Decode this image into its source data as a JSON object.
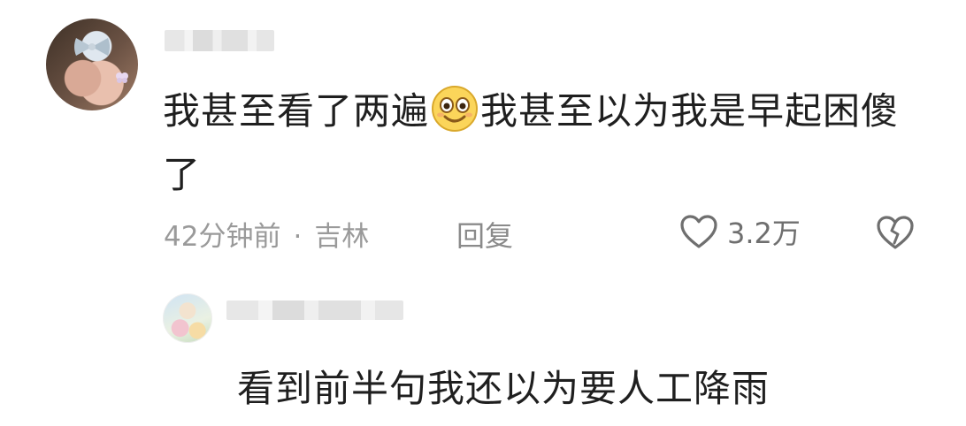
{
  "comment": {
    "text": "我甚至看了两遍😊我甚至以为我是早起困傻了",
    "text_before_emoji": "我甚至看了两遍",
    "emoji": "smiling-face-emoji",
    "text_after_emoji": "我甚至以为我是早起困傻了",
    "time": "42分钟前",
    "separator": "·",
    "location": "吉林",
    "reply_label": "回复",
    "like_count": "3.2万",
    "icons": {
      "like": "heart-outline-icon",
      "dislike": "broken-heart-icon"
    }
  },
  "reply": {
    "text": "看到前半句我还以为要人工降雨"
  },
  "colors": {
    "text": "#1f1f1f",
    "meta": "#9a9a9a",
    "icon": "#6f6f6f"
  }
}
